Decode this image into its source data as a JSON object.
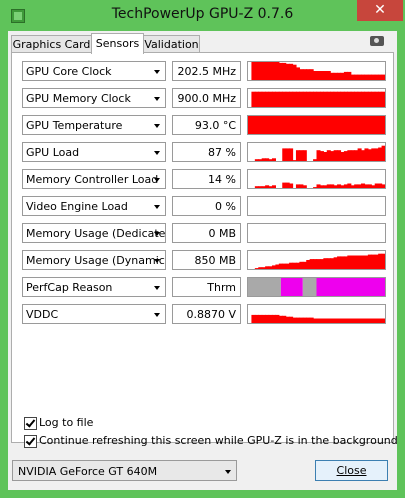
{
  "window": {
    "title": "TechPowerUp GPU-Z 0.7.6",
    "close_glyph": "✕"
  },
  "tabs": [
    {
      "label": "Graphics Card"
    },
    {
      "label": "Sensors"
    },
    {
      "label": "Validation"
    }
  ],
  "sensors": [
    {
      "label": "GPU Core Clock",
      "value": "202.5 MHz",
      "graph": [
        0,
        1,
        1,
        1,
        1,
        1,
        1,
        1,
        1,
        0.95,
        0.95,
        0.9,
        0.9,
        0.85,
        0.7,
        0.6,
        0.6,
        0.6,
        0.6,
        0.5,
        0.5,
        0.5,
        0.5,
        0.5,
        0.4,
        0.4,
        0.4,
        0.4,
        0.45,
        0.45,
        0.3,
        0.3,
        0.3,
        0.3,
        0.3,
        0.3,
        0.3,
        0.3,
        0.3,
        0.3
      ]
    },
    {
      "label": "GPU Memory Clock",
      "value": "900.0 MHz",
      "graph": [
        0,
        0.85,
        0.85,
        0.85,
        0.85,
        0.85,
        0.85,
        0.85,
        0.85,
        0.85,
        0.85,
        0.85,
        0.85,
        0.85,
        0.85,
        0.85,
        0.85,
        0.85,
        0.85,
        0.85,
        0.85,
        0.85,
        0.85,
        0.85,
        0.85,
        0.85,
        0.85,
        0.85,
        0.85,
        0.85,
        0.85,
        0.85,
        0.85,
        0.85,
        0.85,
        0.85,
        0.85,
        0.85,
        0.85,
        0.85
      ]
    },
    {
      "label": "GPU Temperature",
      "value": "93.0 °C",
      "graph": [
        1,
        1,
        1,
        1,
        1,
        1,
        1,
        1,
        1,
        1,
        1,
        1,
        1,
        1,
        1,
        1,
        1,
        1,
        1,
        1,
        1,
        1,
        1,
        1,
        1,
        1,
        1,
        1,
        1,
        1,
        1,
        1,
        1,
        1,
        1,
        1,
        1,
        1,
        1,
        1
      ]
    },
    {
      "label": "GPU Load",
      "value": "87 %",
      "graph": [
        0,
        0,
        0.1,
        0.1,
        0.15,
        0.15,
        0.1,
        0.15,
        0,
        0,
        0.7,
        0.7,
        0.7,
        0.05,
        0.6,
        0.6,
        0.6,
        0,
        0,
        0.1,
        0.6,
        0.55,
        0.5,
        0.6,
        0.55,
        0.6,
        0.6,
        0.5,
        0.55,
        0.6,
        0.6,
        0.6,
        0.7,
        0.6,
        0.7,
        0.65,
        0.7,
        0.7,
        0.75,
        0.85
      ]
    },
    {
      "label": "Memory Controller Load",
      "value": "14 %",
      "graph": [
        0,
        0,
        0.1,
        0.1,
        0.1,
        0.15,
        0.1,
        0.15,
        0,
        0,
        0.3,
        0.3,
        0.25,
        0,
        0.2,
        0.2,
        0.15,
        0,
        0,
        0.05,
        0.2,
        0.15,
        0.15,
        0.2,
        0.2,
        0.15,
        0.2,
        0.15,
        0.2,
        0.25,
        0.15,
        0.2,
        0.2,
        0.25,
        0.2,
        0.2,
        0.15,
        0.25,
        0.25,
        0.2
      ]
    },
    {
      "label": "Video Engine Load",
      "value": "0 %",
      "graph": []
    },
    {
      "label": "Memory Usage (Dedicated)",
      "value": "0 MB",
      "graph": []
    },
    {
      "label": "Memory Usage (Dynamic)",
      "value": "850 MB",
      "graph": [
        0,
        0,
        0.05,
        0.1,
        0.1,
        0.15,
        0.15,
        0.2,
        0.25,
        0.3,
        0.3,
        0.3,
        0.35,
        0.35,
        0.35,
        0.4,
        0.4,
        0.5,
        0.55,
        0.55,
        0.55,
        0.55,
        0.6,
        0.6,
        0.6,
        0.65,
        0.7,
        0.7,
        0.7,
        0.75,
        0.75,
        0.75,
        0.75,
        0.75,
        0.75,
        0.8,
        0.8,
        0.8,
        0.85,
        0.85
      ]
    },
    {
      "label": "PerfCap Reason",
      "value": "Thrm",
      "perfcap": [
        {
          "fraction": 0.24,
          "color": "#a9a9a9"
        },
        {
          "fraction": 0.16,
          "color": "#ee00ee"
        },
        {
          "fraction": 0.1,
          "color": "#a9a9a9"
        },
        {
          "fraction": 0.5,
          "color": "#ee00ee"
        }
      ]
    },
    {
      "label": "VDDC",
      "value": "0.8870 V",
      "graph": [
        0,
        0.45,
        0.45,
        0.45,
        0.45,
        0.45,
        0.45,
        0.45,
        0.45,
        0.4,
        0.4,
        0.35,
        0.35,
        0.3,
        0.3,
        0.3,
        0.3,
        0.3,
        0.3,
        0.25,
        0.25,
        0.25,
        0.25,
        0.25,
        0.25,
        0.25,
        0.25,
        0.25,
        0.25,
        0.25,
        0.25,
        0.25,
        0.25,
        0.25,
        0.25,
        0.25,
        0.25,
        0.25,
        0.25,
        0.25
      ]
    }
  ],
  "options": {
    "log_to_file": "Log to file",
    "continue_refresh": "Continue refreshing this screen while GPU-Z is in the background"
  },
  "gpu_select": {
    "value": "NVIDIA GeForce GT 640M"
  },
  "close_button": {
    "label": "Close"
  },
  "colors": {
    "graph_fill": "#ff0000",
    "accent": "#5fc35a"
  }
}
